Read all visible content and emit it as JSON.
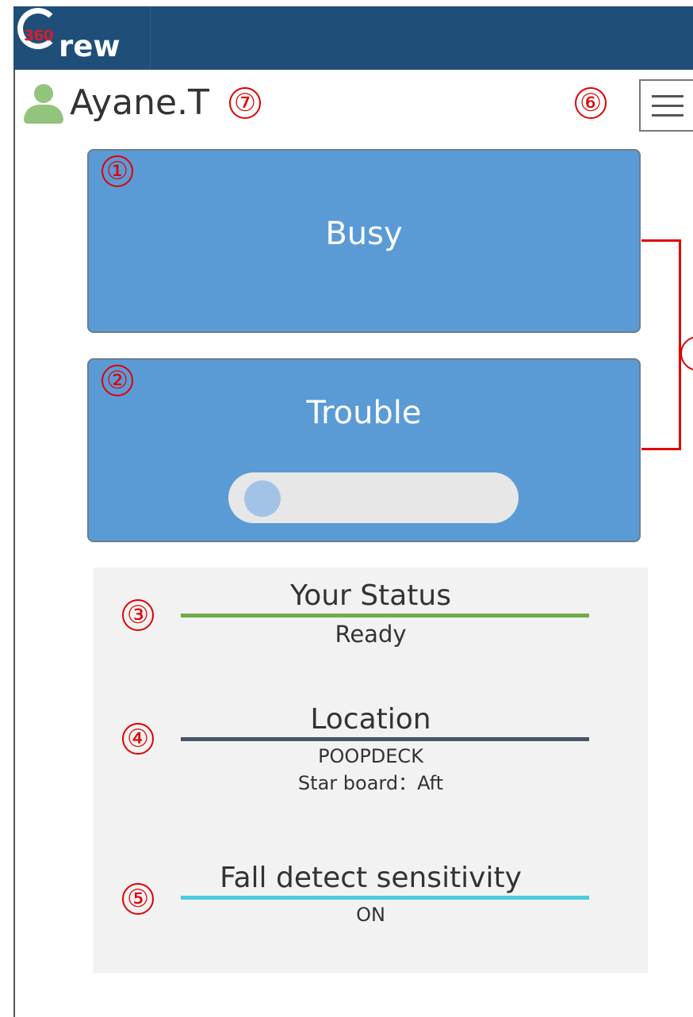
{
  "app": {
    "logo_number": "360",
    "logo_text": "rew"
  },
  "user": {
    "name": "Ayane.T"
  },
  "annotations": {
    "n1": "①",
    "n2": "②",
    "n3": "③",
    "n4": "④",
    "n5": "⑤",
    "n6": "⑥",
    "n7": "⑦"
  },
  "buttons": {
    "busy_label": "Busy",
    "trouble_label": "Trouble"
  },
  "trouble_toggle": {
    "state": "off"
  },
  "status": {
    "your_status_title": "Your Status",
    "your_status_value": "Ready",
    "location_title": "Location",
    "location_area": "POOPDECK",
    "location_detail": "Star board：Aft",
    "fall_title": "Fall detect sensitivity",
    "fall_value": "ON"
  },
  "colors": {
    "header_bg": "#1f4e79",
    "button_bg": "#5b9bd5",
    "annotation_red": "#e00000",
    "status_line": "#70ad47",
    "location_line": "#44546a",
    "fall_line": "#4ecbdc"
  }
}
